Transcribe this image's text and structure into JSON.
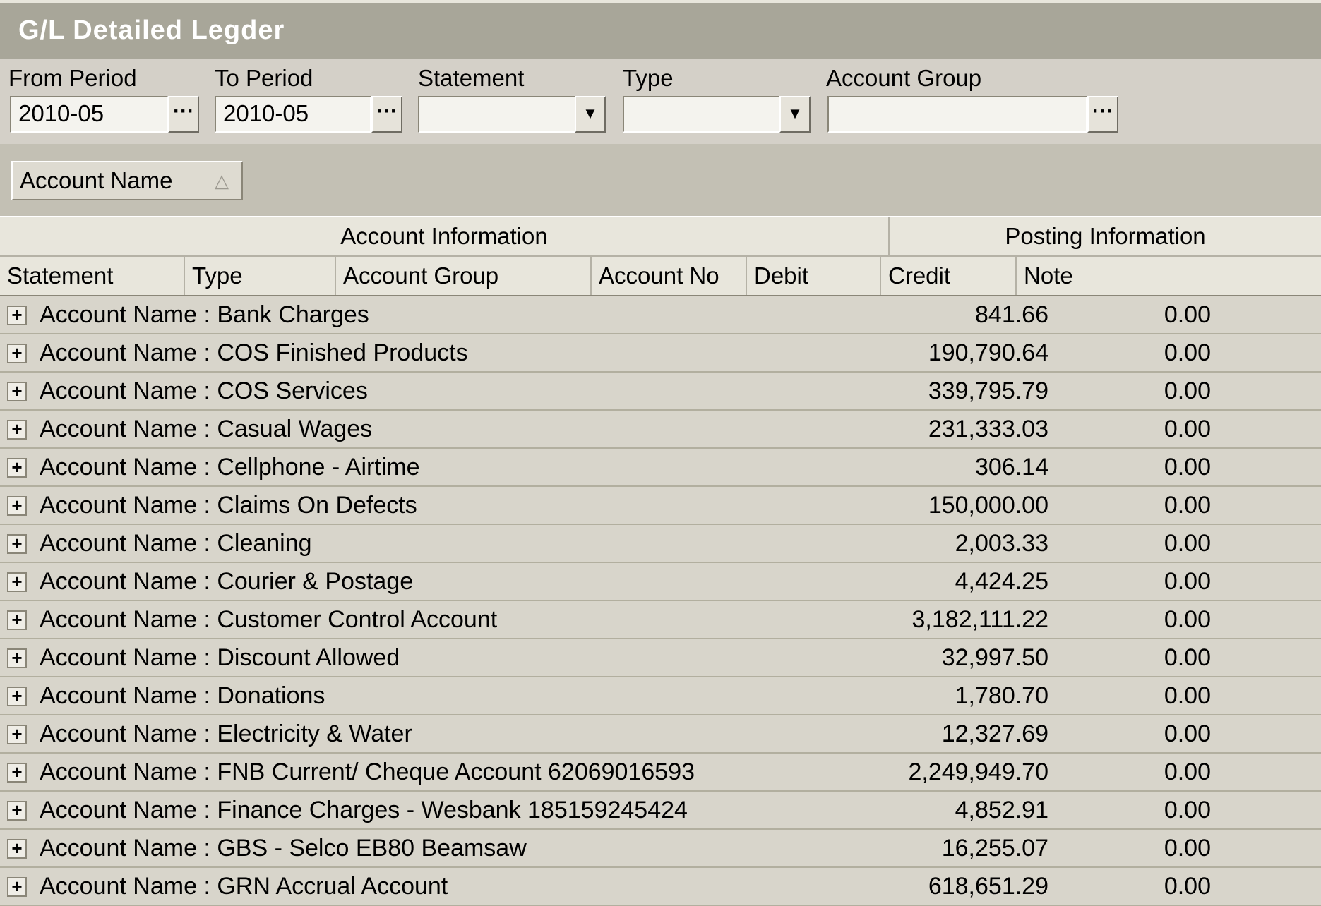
{
  "window": {
    "title": "G/L Detailed Legder"
  },
  "filters": {
    "from_period": {
      "label": "From Period",
      "value": "2010-05"
    },
    "to_period": {
      "label": "To Period",
      "value": "2010-05"
    },
    "statement": {
      "label": "Statement",
      "value": ""
    },
    "type": {
      "label": "Type",
      "value": ""
    },
    "account_group": {
      "label": "Account Group",
      "value": ""
    },
    "ellipsis": "···",
    "dropdown_arrow": "▼"
  },
  "group_panel": {
    "chip_label": "Account Name",
    "sort_icon": "△"
  },
  "grid": {
    "bands": {
      "account_information": "Account Information",
      "posting_information": "Posting Information"
    },
    "columns": {
      "statement": "Statement",
      "type": "Type",
      "account_group": "Account Group",
      "account_no": "Account No",
      "debit": "Debit",
      "credit": "Credit",
      "note": "Note"
    },
    "expand_glyph": "+",
    "rows": [
      {
        "label": "Account Name : Bank Charges",
        "debit": "841.66",
        "credit": "0.00"
      },
      {
        "label": "Account Name : COS Finished Products",
        "debit": "190,790.64",
        "credit": "0.00"
      },
      {
        "label": "Account Name : COS Services",
        "debit": "339,795.79",
        "credit": "0.00"
      },
      {
        "label": "Account Name : Casual Wages",
        "debit": "231,333.03",
        "credit": "0.00"
      },
      {
        "label": "Account Name : Cellphone - Airtime",
        "debit": "306.14",
        "credit": "0.00"
      },
      {
        "label": "Account Name : Claims On Defects",
        "debit": "150,000.00",
        "credit": "0.00"
      },
      {
        "label": "Account Name : Cleaning",
        "debit": "2,003.33",
        "credit": "0.00"
      },
      {
        "label": "Account Name : Courier & Postage",
        "debit": "4,424.25",
        "credit": "0.00"
      },
      {
        "label": "Account Name : Customer Control Account",
        "debit": "3,182,111.22",
        "credit": "0.00"
      },
      {
        "label": "Account Name : Discount Allowed",
        "debit": "32,997.50",
        "credit": "0.00"
      },
      {
        "label": "Account Name : Donations",
        "debit": "1,780.70",
        "credit": "0.00"
      },
      {
        "label": "Account Name : Electricity & Water",
        "debit": "12,327.69",
        "credit": "0.00"
      },
      {
        "label": "Account Name : FNB Current/ Cheque Account 62069016593",
        "debit": "2,249,949.70",
        "credit": "0.00"
      },
      {
        "label": "Account Name : Finance Charges - Wesbank 185159245424",
        "debit": "4,852.91",
        "credit": "0.00"
      },
      {
        "label": "Account Name : GBS - Selco EB80 Beamsaw",
        "debit": "16,255.07",
        "credit": "0.00"
      },
      {
        "label": "Account Name : GRN Accrual Account",
        "debit": "618,651.29",
        "credit": "0.00"
      }
    ]
  }
}
